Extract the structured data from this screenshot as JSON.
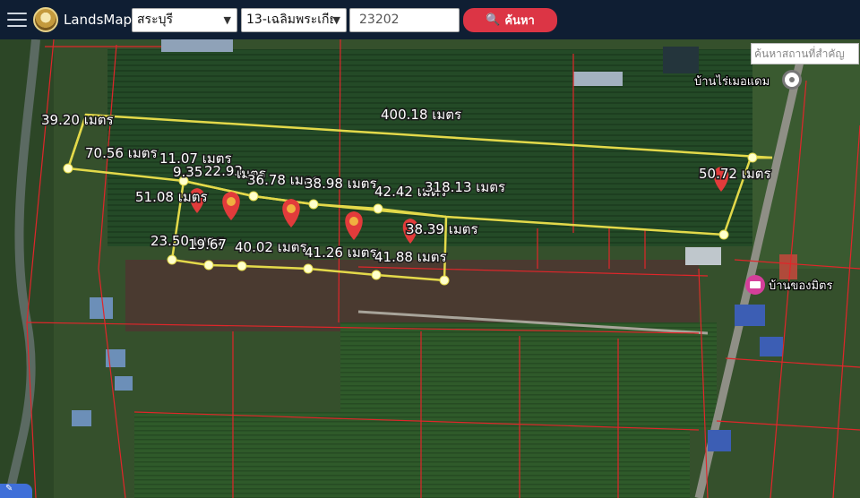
{
  "header": {
    "brand": "LandsMaps",
    "province": "สระบุรี",
    "district": "13-เฉลิมพระเกียรติ",
    "parcel_no": "23202",
    "search_label": "ค้นหา"
  },
  "place_search": {
    "placeholder": "ค้นหาสถานที่สำคัญ"
  },
  "map": {
    "places": [
      {
        "label": "บ้านไร่เมอแดม"
      },
      {
        "label": "บ้านของมิตร"
      }
    ],
    "measurements": [
      "39.20 เมตร",
      "400.18 เมตร",
      "70.56 เมตร",
      "11.07 เมตร",
      "9.35",
      "22.93",
      "เมตร",
      "36.78 เมตร",
      "38.98 เมตร",
      "42.42 เมตร",
      "318.13 เมตร",
      "50.72 เมตร",
      "51.08 เมตร",
      "38.39 เมตร",
      "23.50 เมตร",
      "19.67",
      "40.02 เมตร",
      "41.26 เมตร",
      "41.88 เมตร"
    ]
  }
}
